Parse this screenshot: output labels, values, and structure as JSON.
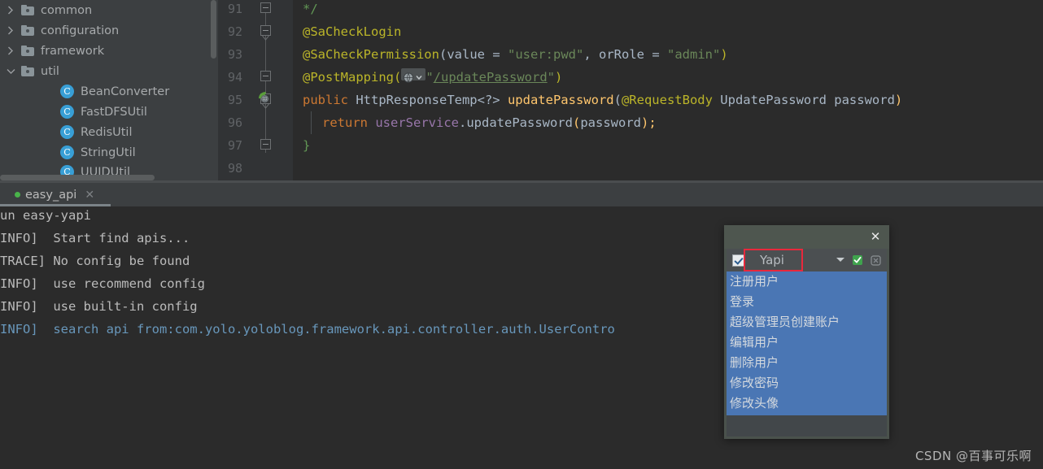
{
  "project_tree": {
    "items": [
      {
        "label": "common",
        "type": "folder",
        "expanded": false,
        "indent": 1
      },
      {
        "label": "configuration",
        "type": "folder",
        "expanded": false,
        "indent": 1
      },
      {
        "label": "framework",
        "type": "folder",
        "expanded": false,
        "indent": 1
      },
      {
        "label": "util",
        "type": "folder",
        "expanded": true,
        "indent": 1
      },
      {
        "label": "BeanConverter",
        "type": "class",
        "indent": 2
      },
      {
        "label": "FastDFSUtil",
        "type": "class",
        "indent": 2
      },
      {
        "label": "RedisUtil",
        "type": "class",
        "indent": 2
      },
      {
        "label": "StringUtil",
        "type": "class",
        "indent": 2
      },
      {
        "label": "UUIDUtil",
        "type": "class",
        "indent": 2
      }
    ]
  },
  "editor": {
    "line_numbers": [
      "91",
      "92",
      "93",
      "94",
      "95",
      "96",
      "97",
      "98"
    ],
    "lines": {
      "l91_comment": "*/",
      "l92_anno": "@SaCheckLogin",
      "l93_anno": "@SaCheckPermission",
      "l93_open": "(",
      "l93_value_key": "value",
      "l93_eq1": " = ",
      "l93_value_str": "\"user:pwd\"",
      "l93_comma": ", ",
      "l93_role_key": "orRole",
      "l93_eq2": " = ",
      "l93_role_str": "\"admin\"",
      "l93_close": ")",
      "l94_anno": "@PostMapping",
      "l94_open": "(",
      "l94_quote1": "\"",
      "l94_path": "/updatePassword",
      "l94_quote2": "\"",
      "l94_close": ")",
      "l95_kw": "public",
      "l95_type": " HttpResponseTemp<?> ",
      "l95_method": "updatePassword",
      "l95_open": "(",
      "l95_anno": "@RequestBody",
      "l95_ptype": " UpdatePassword ",
      "l95_pname": "password",
      "l95_close": ")",
      "l96_kw": "return",
      "l96_field": " userService",
      "l96_dot": ".",
      "l96_call": "updatePassword",
      "l96_open": "(",
      "l96_arg": "password",
      "l96_close": ");",
      "l97_brace": "}"
    },
    "gutter_run_icon": "run-gradle-icon"
  },
  "console": {
    "tab": {
      "label": "easy_api",
      "status_dot": "running-indicator",
      "close_icon": "close-icon"
    },
    "lines": [
      {
        "text": "un easy-yapi",
        "blue": false
      },
      {
        "text": "INFO]  Start find apis...",
        "blue": false
      },
      {
        "text": "TRACE] No config be found",
        "blue": false
      },
      {
        "text": "INFO]  use recommend config",
        "blue": false
      },
      {
        "text": "INFO]  use built-in config",
        "blue": false
      },
      {
        "text": "INFO]  search api from:com.yolo.yoloblog.framework.api.controller.auth.UserContro",
        "blue": false
      }
    ]
  },
  "popup": {
    "close_icon": "close-icon",
    "checkbox_checked": true,
    "combo_value": "Yapi",
    "combo_arrow_icon": "chevron-down-icon",
    "confirm_icon": "ok-check-icon",
    "cancel_icon": "cancel-icon",
    "items": [
      "注册用户",
      "登录",
      "超级管理员创建账户",
      "编辑用户",
      "删除用户",
      "修改密码",
      "修改头像"
    ]
  },
  "watermark": {
    "text": "CSDN @百事可乐啊"
  },
  "colors": {
    "editor_bg": "#2b2b2b",
    "panel_bg": "#3c3f41",
    "gutter_bg": "#313335",
    "selection_blue": "#4a76b4",
    "highlight_red": "#e8283c",
    "accent_green": "#49b34a"
  }
}
